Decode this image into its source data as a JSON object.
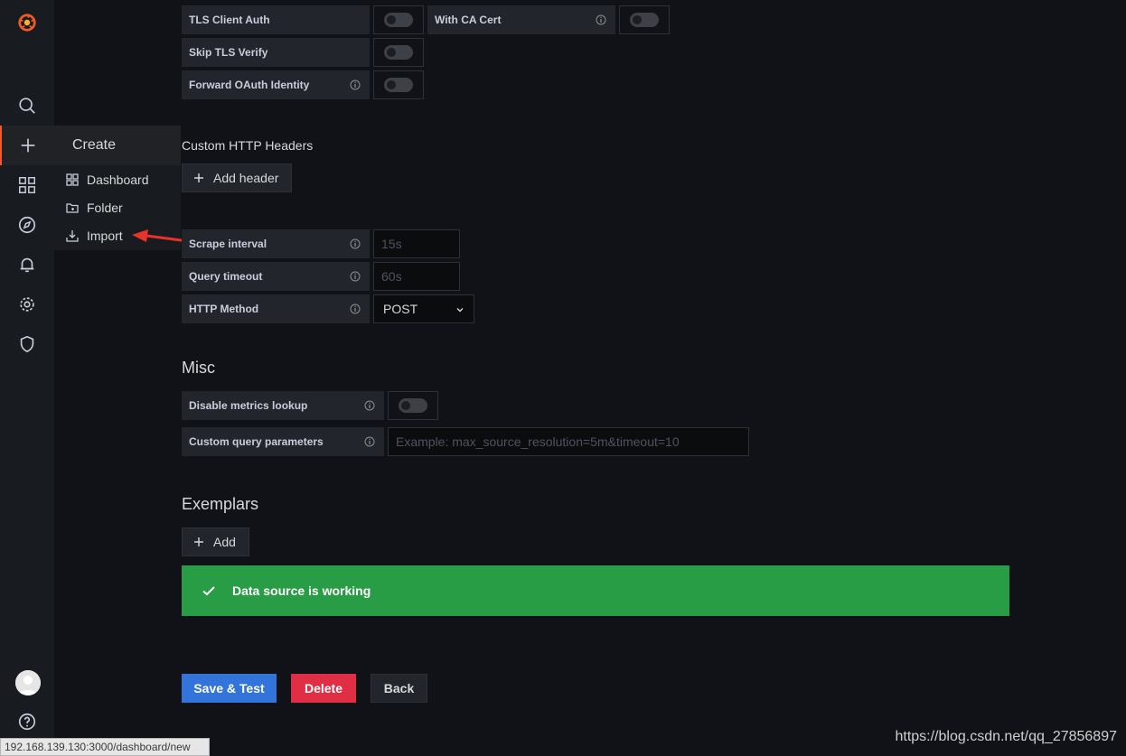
{
  "menu": {
    "header": "Create",
    "items": [
      {
        "label": "Dashboard",
        "icon": "dashboard-grid-icon"
      },
      {
        "label": "Folder",
        "icon": "folder-plus-icon"
      },
      {
        "label": "Import",
        "icon": "import-icon"
      }
    ]
  },
  "auth": {
    "tls_client_auth": "TLS Client Auth",
    "with_ca_cert": "With CA Cert",
    "skip_tls_verify": "Skip TLS Verify",
    "forward_oauth": "Forward OAuth Identity"
  },
  "custom_headers": {
    "title": "Custom HTTP Headers",
    "add_button": "Add header"
  },
  "settings": {
    "scrape_interval_label": "Scrape interval",
    "scrape_interval_placeholder": "15s",
    "query_timeout_label": "Query timeout",
    "query_timeout_placeholder": "60s",
    "http_method_label": "HTTP Method",
    "http_method_value": "POST"
  },
  "misc": {
    "title": "Misc",
    "disable_metrics_label": "Disable metrics lookup",
    "custom_query_label": "Custom query parameters",
    "custom_query_placeholder": "Example: max_source_resolution=5m&timeout=10"
  },
  "exemplars": {
    "title": "Exemplars",
    "add_button": "Add"
  },
  "alert": {
    "message": "Data source is working",
    "color": "#299c46"
  },
  "actions": {
    "save_test": "Save & Test",
    "delete": "Delete",
    "back": "Back",
    "save_color": "#3274d9",
    "delete_color": "#d44a3a"
  },
  "status_bar": {
    "url": "192.168.139.130:3000/dashboard/new"
  },
  "watermark": "https://blog.csdn.net/qq_27856897"
}
